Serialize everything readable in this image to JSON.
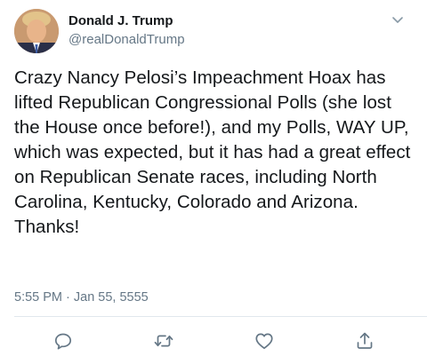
{
  "author": {
    "display_name": "Donald J. Trump",
    "handle": "@realDonaldTrump",
    "avatar_icon": "profile-photo"
  },
  "tweet": {
    "text": "Crazy Nancy Pelosi’s Impeachment Hoax has lifted Republican Congressional Polls (she lost the House once before!), and my Polls, WAY UP, which was expected, but it has had a great effect on Republican Senate races, including North Carolina, Kentucky, Colorado and Arizona. Thanks!",
    "timestamp": "5:55 PM · Jan 55, 5555"
  },
  "actions": {
    "reply_icon": "reply-icon",
    "retweet_icon": "retweet-icon",
    "like_icon": "heart-icon",
    "share_icon": "share-icon"
  },
  "colors": {
    "text": "#14171a",
    "secondary": "#657786",
    "divider": "#e1e8ed"
  }
}
